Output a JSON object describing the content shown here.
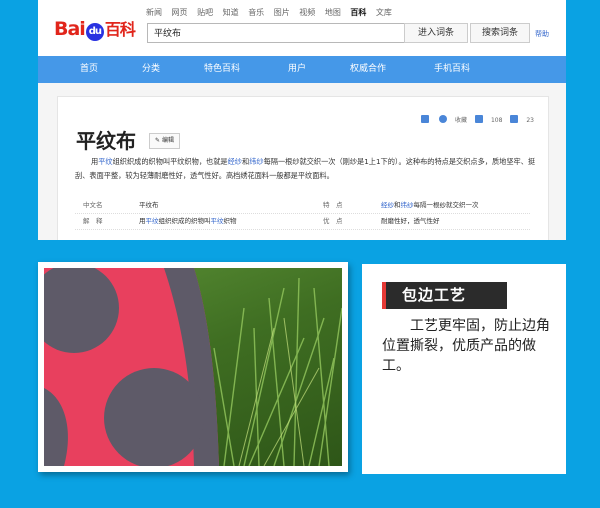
{
  "header": {
    "logo_text_bai": "Bai",
    "logo_paw": "du",
    "logo_text_baike": "百科",
    "top_nav": [
      "新闻",
      "网页",
      "贴吧",
      "知道",
      "音乐",
      "图片",
      "视频",
      "地图",
      "百科",
      "文库"
    ],
    "active_top_nav": "百科",
    "search_value": "平纹布",
    "enter_button": "进入词条",
    "search_button": "搜索词条",
    "help": "帮助"
  },
  "main_nav": [
    "首页",
    "分类",
    "特色百科",
    "用户",
    "权威合作",
    "手机百科"
  ],
  "entry": {
    "title": "平纹布",
    "edit_label": "编辑",
    "collect_label": "收藏",
    "like_count": "108",
    "share_count": "23",
    "desc_parts": [
      "用",
      "平纹",
      "组织织成的织物叫平纹织物，也就是",
      "经纱",
      "和",
      "纬纱",
      "每隔一根纱就交织一次（刚纱是1上1下的）。这种布的特点是交织点多，质地坚牢、挺刮、表面平整，较为轻薄耐磨性好，透气性好。高档绣花面料一般都是平纹面料。"
    ],
    "info_rows": [
      {
        "k1": "中文名",
        "v1": "平纹布",
        "k2": "特　点",
        "v2a": "经纱",
        "v2b": "和",
        "v2c": "纬纱",
        "v2d": "每隔一根纱就交织一次"
      },
      {
        "k1": "解　释",
        "v1a": "用",
        "v1b": "平纹",
        "v1c": "组织织成的织物叫",
        "v1d": "平纹",
        "v1e": "织物",
        "k2": "优　点",
        "v2": "耐磨性好，透气性好"
      }
    ]
  },
  "feature": {
    "tag": "包边工艺",
    "text": "工艺更牢固，防止边角位置撕裂，优质产品的做工。"
  },
  "colors": {
    "page_bg": "#0aa2e3",
    "nav_bg": "#4598e8",
    "fabric_pink": "#e8405e",
    "fabric_gray": "#5e5a68"
  }
}
